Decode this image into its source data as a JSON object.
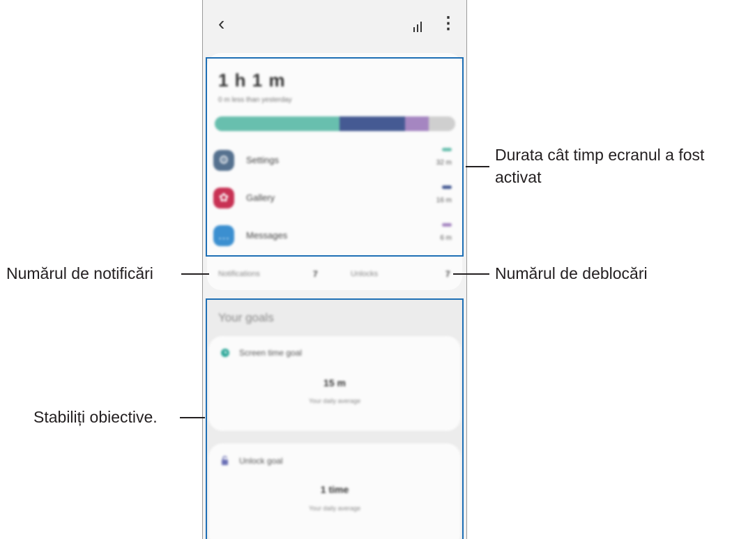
{
  "topbar": {
    "back_icon": "chevron-left-icon",
    "chart_icon": "bar-chart-icon",
    "more_icon": "more-vertical-icon"
  },
  "summary": {
    "total_time": "1 h 1 m",
    "compare_text": "0 m less than yesterday",
    "usage_bar": [
      {
        "color": "#68bfae",
        "fraction": 0.52
      },
      {
        "color": "#455a93",
        "fraction": 0.27
      },
      {
        "color": "#a586c1",
        "fraction": 0.1
      },
      {
        "color": "#cfcfcf",
        "fraction": 0.11
      }
    ],
    "apps": [
      {
        "name": "Settings",
        "time": "32 m",
        "icon": "gear-icon",
        "glyph": "⚙",
        "color": "#55718f",
        "pill": "#68bfae"
      },
      {
        "name": "Gallery",
        "time": "16 m",
        "icon": "flower-icon",
        "glyph": "✿",
        "color": "#c83254",
        "pill": "#455a93"
      },
      {
        "name": "Messages",
        "time": "6 m",
        "icon": "chat-bubble-icon",
        "glyph": "…",
        "color": "#3b8fd0",
        "pill": "#a586c1"
      }
    ]
  },
  "stats": {
    "notifications_label": "Notifications",
    "notifications_value": "7",
    "unlocks_label": "Unlocks",
    "unlocks_value": "7"
  },
  "goals": {
    "heading": "Your goals",
    "screen_time": {
      "title": "Screen time goal",
      "value": "15 m",
      "sub": "Your daily average",
      "icon": "clock-icon"
    },
    "unlock": {
      "title": "Unlock goal",
      "value": "1 time",
      "sub": "Your daily average",
      "icon": "lock-icon"
    }
  },
  "callouts": {
    "screen_time": "Durata cât timp ecranul a fost activat",
    "notifications": "Numărul de notificări",
    "unlocks": "Numărul de deblocări",
    "goals": "Stabiliți obiective."
  },
  "colors": {
    "highlight": "#1e6fb5"
  }
}
